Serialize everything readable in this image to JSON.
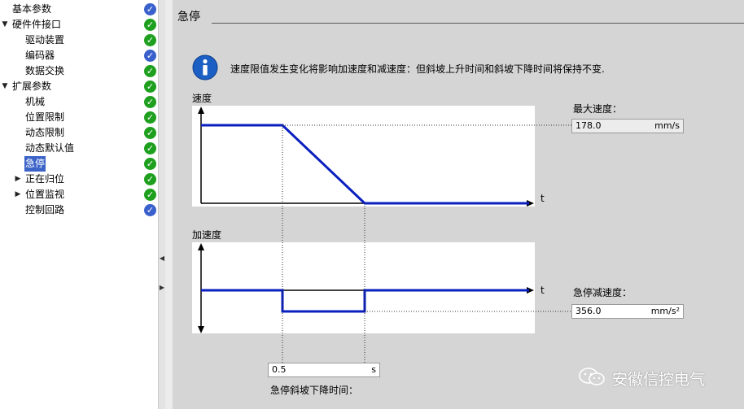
{
  "tree": [
    {
      "label": "基本参数",
      "indent": 0,
      "toggle": "",
      "status": "blue",
      "selected": false
    },
    {
      "label": "硬件件接口",
      "indent": 0,
      "toggle": "▼",
      "status": "ok",
      "selected": false
    },
    {
      "label": "驱动装置",
      "indent": 2,
      "toggle": "",
      "status": "ok",
      "selected": false
    },
    {
      "label": "编码器",
      "indent": 2,
      "toggle": "",
      "status": "blue",
      "selected": false
    },
    {
      "label": "数据交换",
      "indent": 2,
      "toggle": "",
      "status": "ok",
      "selected": false
    },
    {
      "label": "扩展参数",
      "indent": 0,
      "toggle": "▼",
      "status": "ok",
      "selected": false
    },
    {
      "label": "机械",
      "indent": 2,
      "toggle": "",
      "status": "ok",
      "selected": false
    },
    {
      "label": "位置限制",
      "indent": 2,
      "toggle": "",
      "status": "ok",
      "selected": false
    },
    {
      "label": "动态限制",
      "indent": 2,
      "toggle": "",
      "status": "ok",
      "selected": false
    },
    {
      "label": "动态默认值",
      "indent": 2,
      "toggle": "",
      "status": "ok",
      "selected": false
    },
    {
      "label": "急停",
      "indent": 2,
      "toggle": "",
      "status": "ok",
      "selected": true
    },
    {
      "label": "正在归位",
      "indent": 2,
      "toggle": "▶",
      "status": "ok",
      "selected": false
    },
    {
      "label": "位置监视",
      "indent": 2,
      "toggle": "▶",
      "status": "ok",
      "selected": false
    },
    {
      "label": "控制回路",
      "indent": 2,
      "toggle": "",
      "status": "blue",
      "selected": false
    }
  ],
  "panel": {
    "title": "急停",
    "info_text": "速度限值发生变化将影响加速度和减速度：但斜坡上升时间和斜坡下降时间将保持不变.",
    "velocity_label": "速度",
    "acceleration_label": "加速度",
    "t_axis": "t",
    "max_speed": {
      "label": "最大速度：",
      "value": "178.0",
      "unit": "mm/s"
    },
    "decel": {
      "label": "急停减速度：",
      "value": "356.0",
      "unit": "mm/s²"
    },
    "ramp": {
      "label": "急停斜坡下降时间：",
      "value": "0.5",
      "unit": "s"
    }
  },
  "watermark": {
    "text": "安徽信控电气"
  },
  "colors": {
    "accent": "#0a1fbf",
    "ok": "#1ea01e",
    "status_blue": "#3a60cc",
    "selection": "#3c64c8",
    "panel_bg": "#d5d5d5"
  }
}
